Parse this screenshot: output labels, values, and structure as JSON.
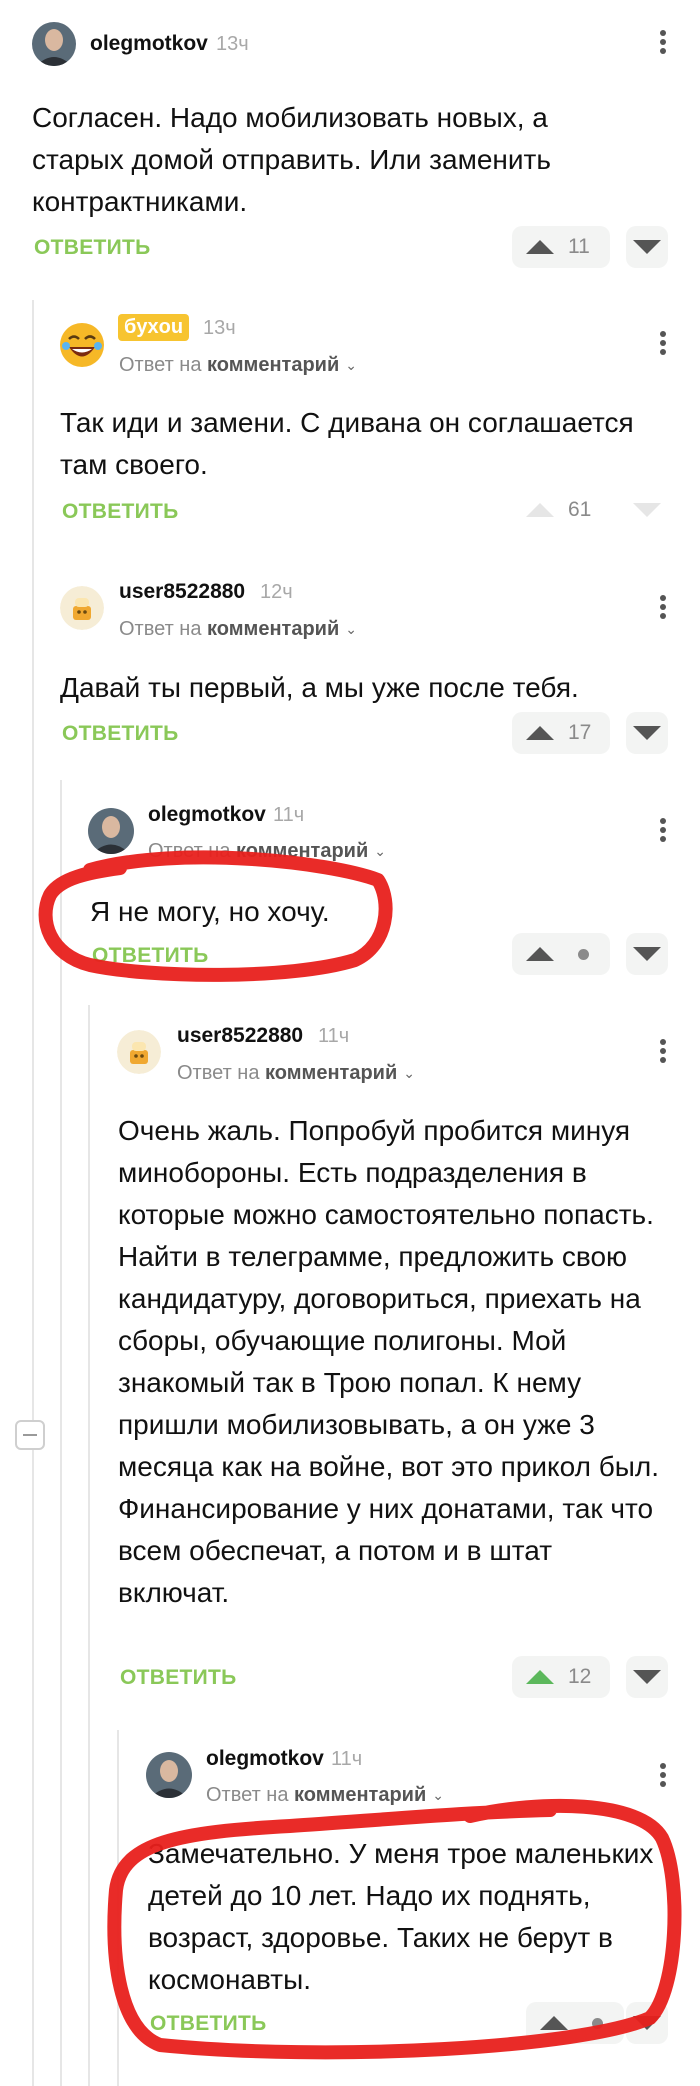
{
  "comments": [
    {
      "username": "olegmotkov",
      "time": "13ч",
      "text": "Согласен. Надо мобилизовать новых, а старых домой отправить. Или заменить контрактниками.",
      "reply_label": "ОТВЕТИТЬ",
      "rating": "11",
      "avatar_icon": "user-photo-icon"
    },
    {
      "username": "бyxou",
      "time": "13ч",
      "reply_to_prefix": "Ответ на",
      "reply_to_link": "комментарий",
      "text": "Так иди и замени. С дивана он соглашается там своего.",
      "reply_label": "ОТВЕТИТЬ",
      "rating": "61",
      "avatar_icon": "laughing-emoji-icon"
    },
    {
      "username": "user8522880",
      "time": "12ч",
      "reply_to_prefix": "Ответ на",
      "reply_to_link": "комментарий",
      "text": "Давай ты первый, а мы уже после тебя.",
      "reply_label": "ОТВЕТИТЬ",
      "rating": "17",
      "avatar_icon": "default-avatar-icon"
    },
    {
      "username": "olegmotkov",
      "time": "11ч",
      "reply_to_prefix": "Ответ на",
      "reply_to_link": "комментарий",
      "text": "Я не могу, но хочу.",
      "reply_label": "ОТВЕТИТЬ",
      "avatar_icon": "user-photo-icon"
    },
    {
      "username": "user8522880",
      "time": "11ч",
      "reply_to_prefix": "Ответ на",
      "reply_to_link": "комментарий",
      "text": "Очень жаль. Попробуй пробится минуя минобороны. Есть подразделения в которые можно самостоятельно попасть. Найти в телеграмме, предложить свою кандидатуру, договориться, приехать на сборы, обучающие полигоны. Мой знакомый так в Трою попал. К нему пришли мобилизовывать, а он уже 3 месяца как на войне, вот это прикол был. Финансирование у них донатами, так что всем обеспечат, а потом и в штат включат.",
      "reply_label": "ОТВЕТИТЬ",
      "rating": "12",
      "avatar_icon": "default-avatar-icon"
    },
    {
      "username": "olegmotkov",
      "time": "11ч",
      "reply_to_prefix": "Ответ на",
      "reply_to_link": "комментарий",
      "text": "Замечательно. У меня трое маленьких детей до 10 лет. Надо их поднять, возраст, здоровье. Таких не берут в космонавты.",
      "reply_label": "ОТВЕТИТЬ",
      "avatar_icon": "user-photo-icon"
    }
  ],
  "colors": {
    "accent_green": "#8ac858",
    "upvoted_green": "#5cb85c",
    "annotation_red": "#e8201c",
    "badge_yellow": "#f7c430"
  }
}
